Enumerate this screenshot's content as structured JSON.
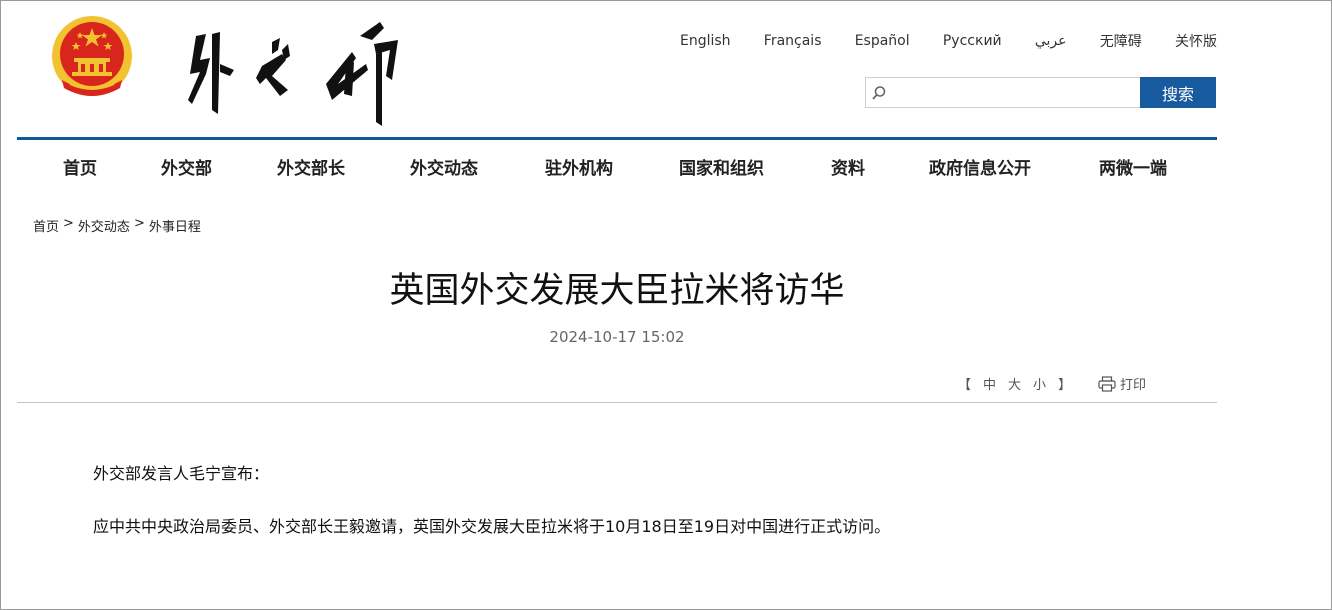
{
  "header": {
    "emblem_icon": "national-emblem-icon",
    "logo_icon": "ministry-calligraphy-logo",
    "languages": [
      "English",
      "Français",
      "Español",
      "Русский",
      "عربي",
      "无障碍",
      "关怀版"
    ],
    "search": {
      "placeholder": "",
      "value": "",
      "button_label": "搜索",
      "icon": "search-icon"
    }
  },
  "nav": {
    "items": [
      "首页",
      "外交部",
      "外交部长",
      "外交动态",
      "驻外机构",
      "国家和组织",
      "资料",
      "政府信息公开",
      "两微一端"
    ]
  },
  "breadcrumb": {
    "items": [
      "首页",
      "外交动态",
      "外事日程"
    ],
    "separator": ">"
  },
  "article": {
    "title": "英国外交发展大臣拉米将访华",
    "date": "2024-10-17 15:02",
    "font_size": {
      "open_bracket": "【",
      "options": [
        "中",
        "大",
        "小"
      ],
      "close_bracket": "】"
    },
    "print_label": "打印",
    "print_icon": "printer-icon",
    "paragraphs": [
      "外交部发言人毛宁宣布：",
      "应中共中央政治局委员、外交部长王毅邀请，英国外交发展大臣拉米将于10月18日至19日对中国进行正式访问。"
    ]
  },
  "colors": {
    "accent": "#185a9e",
    "nav_rule": "#0f5a96",
    "emblem_red": "#d9261c",
    "emblem_gold": "#f2c230"
  }
}
